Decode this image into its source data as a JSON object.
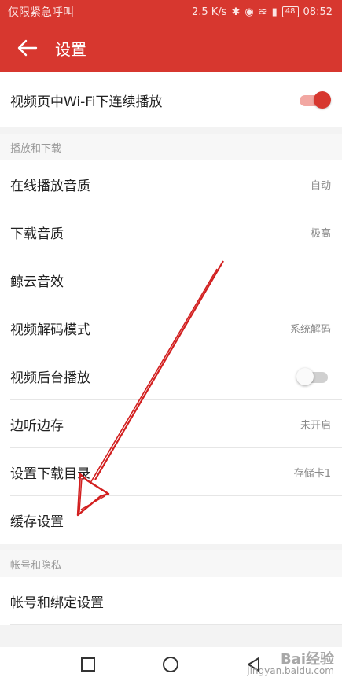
{
  "status_bar": {
    "carrier_text": "仅限紧急呼叫",
    "net_speed": "2.5 K/s",
    "battery": "48",
    "time": "08:52"
  },
  "app_bar": {
    "title": "设置"
  },
  "top_setting": {
    "label": "视频页中Wi-Fi下连续播放",
    "toggle_on": true
  },
  "section_play": {
    "header": "播放和下载",
    "items": [
      {
        "label": "在线播放音质",
        "value": "自动"
      },
      {
        "label": "下载音质",
        "value": "极高"
      },
      {
        "label": "鲸云音效",
        "value": ""
      },
      {
        "label": "视频解码模式",
        "value": "系统解码"
      },
      {
        "label": "视频后台播放",
        "value": "",
        "toggle_on": false
      },
      {
        "label": "边听边存",
        "value": "未开启"
      },
      {
        "label": "设置下载目录",
        "value": "存储卡1"
      },
      {
        "label": "缓存设置",
        "value": ""
      }
    ]
  },
  "section_account": {
    "header": "帐号和隐私",
    "items": [
      {
        "label": "帐号和绑定设置"
      }
    ]
  },
  "watermark": {
    "brand": "Bai经验",
    "url": "jingyan.baidu.com"
  },
  "colors": {
    "accent": "#d7372f",
    "annotation_arrow": "#d21f1f"
  },
  "nav_icons": [
    "square-icon",
    "circle-icon",
    "triangle-icon"
  ]
}
